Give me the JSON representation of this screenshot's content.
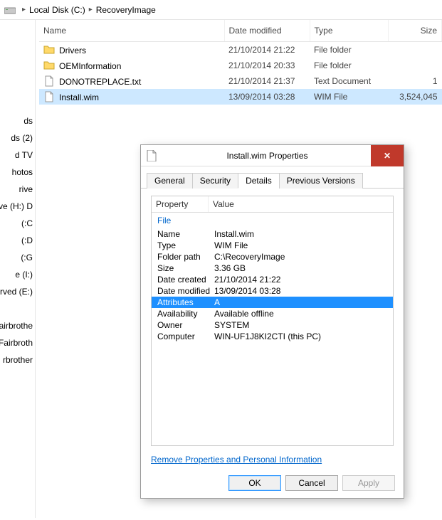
{
  "breadcrumb": {
    "disk": "Local Disk (C:)",
    "folder": "RecoveryImage"
  },
  "columns": {
    "name": "Name",
    "date": "Date modified",
    "type": "Type",
    "size": "Size"
  },
  "files": [
    {
      "icon": "folder",
      "name": "Drivers",
      "date": "21/10/2014 21:22",
      "type": "File folder",
      "size": ""
    },
    {
      "icon": "folder",
      "name": "OEMInformation",
      "date": "21/10/2014 20:33",
      "type": "File folder",
      "size": ""
    },
    {
      "icon": "file",
      "name": "DONOTREPLACE.txt",
      "date": "21/10/2014 21:37",
      "type": "Text Document",
      "size": "1"
    },
    {
      "icon": "file",
      "name": "Install.wim",
      "date": "13/09/2014 03:28",
      "type": "WIM File",
      "size": "3,524,045",
      "selected": true
    }
  ],
  "leftnav": [
    "ds",
    "ds (2)",
    "d TV",
    "hotos",
    "rive",
    "ve (H:) D",
    "C:)",
    "D:)",
    "G:)",
    "e (I:)",
    "rved (E:)",
    "",
    "Fairbrothe",
    "Fairbroth",
    "rbrother"
  ],
  "dialog": {
    "title": "Install.wim Properties",
    "tabs": [
      "General",
      "Security",
      "Details",
      "Previous Versions"
    ],
    "activeTab": 2,
    "headProp": "Property",
    "headVal": "Value",
    "group": "File",
    "props": [
      {
        "k": "Name",
        "v": "Install.wim"
      },
      {
        "k": "Type",
        "v": "WIM File"
      },
      {
        "k": "Folder path",
        "v": "C:\\RecoveryImage"
      },
      {
        "k": "Size",
        "v": "3.36 GB"
      },
      {
        "k": "Date created",
        "v": "21/10/2014 21:22"
      },
      {
        "k": "Date modified",
        "v": "13/09/2014 03:28"
      },
      {
        "k": "Attributes",
        "v": "A",
        "selected": true
      },
      {
        "k": "Availability",
        "v": "Available offline"
      },
      {
        "k": "Owner",
        "v": "SYSTEM"
      },
      {
        "k": "Computer",
        "v": "WIN-UF1J8KI2CTI (this PC)"
      }
    ],
    "link": "Remove Properties and Personal Information",
    "buttons": {
      "ok": "OK",
      "cancel": "Cancel",
      "apply": "Apply"
    }
  }
}
